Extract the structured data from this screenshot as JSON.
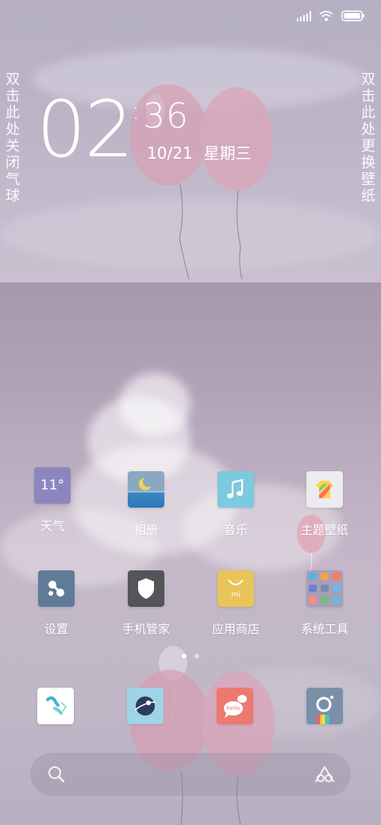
{
  "status_bar": {
    "icons": [
      "signal-icon",
      "wifi-icon",
      "battery-icon"
    ]
  },
  "hints": {
    "left": "双击此处关闭气球",
    "right": "双击此处更换壁纸"
  },
  "clock": {
    "hour": "02",
    "minute": "36",
    "date": "10/21",
    "weekday": "星期三"
  },
  "apps": [
    {
      "label": "天气",
      "icon": "weather-icon",
      "badge": "11°",
      "color": "#8b87be"
    },
    {
      "label": "相册",
      "icon": "gallery-icon",
      "color": "#4a85b8"
    },
    {
      "label": "音乐",
      "icon": "music-icon",
      "color": "#7dc9df"
    },
    {
      "label": "主题壁纸",
      "icon": "themes-icon",
      "color": "#e8e8ea"
    },
    {
      "label": "设置",
      "icon": "settings-icon",
      "color": "#5f7b98"
    },
    {
      "label": "手机管家",
      "icon": "security-icon",
      "color": "#555459"
    },
    {
      "label": "应用商店",
      "icon": "app-store-icon",
      "badge": "mi",
      "color": "#e8c45a"
    },
    {
      "label": "系统工具",
      "icon": "system-tools-folder-icon",
      "color": "#8e8aaa"
    }
  ],
  "dock": [
    {
      "icon": "phone-icon",
      "color": "#ffffff"
    },
    {
      "icon": "browser-icon",
      "color": "#9fd3e6"
    },
    {
      "icon": "messages-icon",
      "badge": "hello",
      "color": "#ec7a6e"
    },
    {
      "icon": "camera-icon",
      "color": "#7b8fa8"
    }
  ],
  "pager": {
    "pages": 2,
    "current": 1
  },
  "search": {
    "placeholder": "",
    "left_icon": "search-icon",
    "right_icon": "assistant-icon"
  }
}
